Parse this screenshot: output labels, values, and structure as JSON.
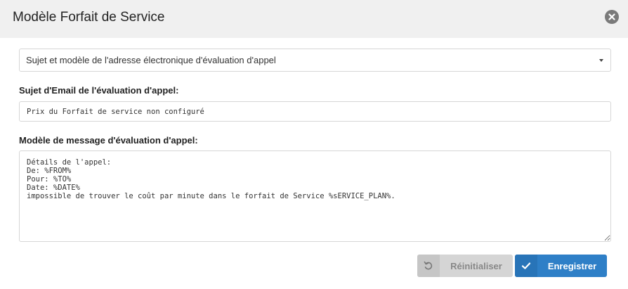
{
  "header": {
    "title": "Modèle Forfait de Service",
    "close_icon": "close-circle-icon"
  },
  "template_select": {
    "selected": "Sujet et modèle de l'adresse électronique d'évaluation d'appel"
  },
  "subject": {
    "label": "Sujet d'Email de l'évaluation d'appel:",
    "value": "Prix du Forfait de service non configuré"
  },
  "message": {
    "label": "Modèle de message d'évaluation d'appel:",
    "value": "Détails de l'appel:\nDe: %FROM%\nPour: %TO%\nDate: %DATE%\nimpossible de trouver le coût par minute dans le forfait de Service %sERVICE_PLAN%."
  },
  "buttons": {
    "reset_label": "Réinitialiser",
    "reset_icon": "undo-icon",
    "save_label": "Enregistrer",
    "save_icon": "check-icon"
  },
  "colors": {
    "header_bg": "#f0f0f0",
    "save_button": "#2e7fc7",
    "reset_button": "#d5d5d5"
  }
}
